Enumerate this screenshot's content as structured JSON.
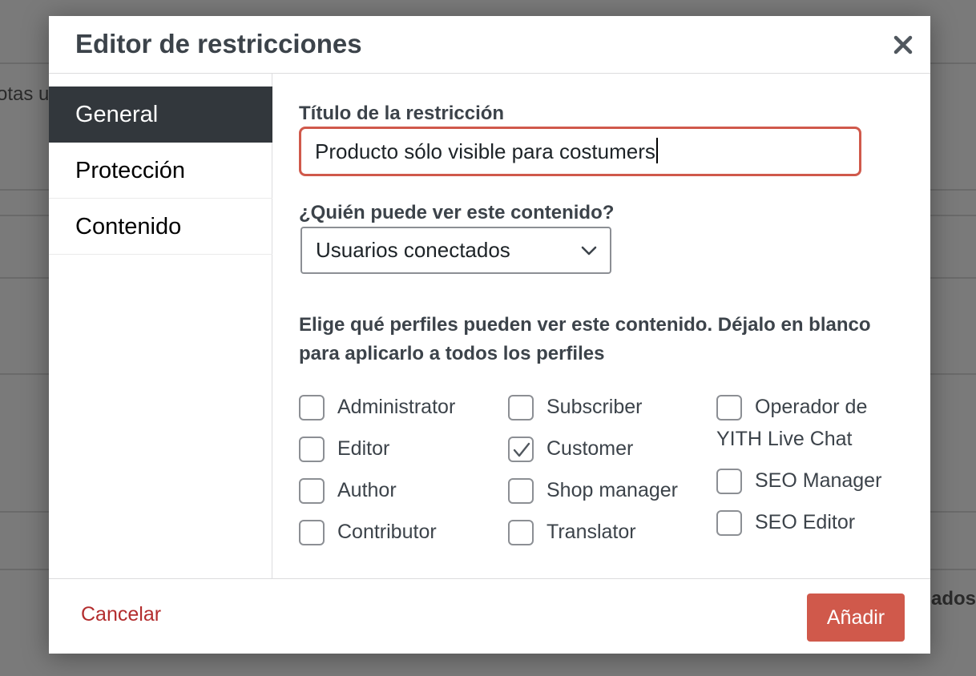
{
  "background": {
    "partial_text_left": "otas u",
    "partial_text_right": "ados"
  },
  "modal": {
    "title": "Editor de restricciones",
    "close_icon": "close-icon"
  },
  "sidebar": {
    "items": [
      {
        "label": "General",
        "active": true
      },
      {
        "label": "Protección",
        "active": false
      },
      {
        "label": "Contenido",
        "active": false
      }
    ]
  },
  "form": {
    "title_label": "Título de la restricción",
    "title_value": "Producto sólo visible para costumers",
    "who_label": "¿Quién puede ver este contenido?",
    "who_selected": "Usuarios conectados",
    "roles_description": "Elige qué perfiles pueden ver este contenido. Déjalo en blanco para aplicarlo a todos los perfiles",
    "roles": [
      {
        "label": "Administrator",
        "checked": false
      },
      {
        "label": "Editor",
        "checked": false
      },
      {
        "label": "Author",
        "checked": false
      },
      {
        "label": "Contributor",
        "checked": false
      },
      {
        "label": "Subscriber",
        "checked": false
      },
      {
        "label": "Customer",
        "checked": true
      },
      {
        "label": "Shop manager",
        "checked": false
      },
      {
        "label": "Translator",
        "checked": false
      },
      {
        "label": "Operador de YITH Live Chat",
        "checked": false
      },
      {
        "label": "SEO Manager",
        "checked": false
      },
      {
        "label": "SEO Editor",
        "checked": false
      }
    ]
  },
  "footer": {
    "cancel_label": "Cancelar",
    "add_label": "Añadir"
  },
  "colors": {
    "accent": "#d0594b",
    "cancel": "#b32d2e",
    "sidebar_active": "#32373c"
  }
}
